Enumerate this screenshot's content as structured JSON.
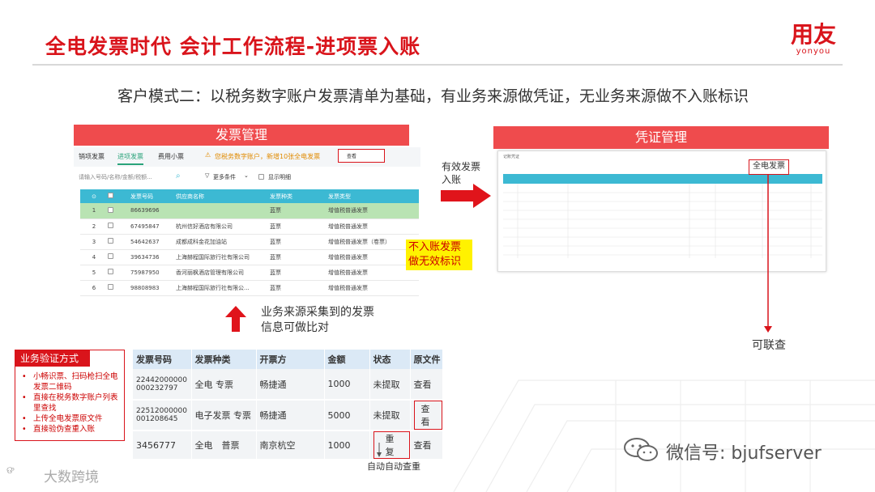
{
  "slide": {
    "title": "全电发票时代 会计工作流程-进项票入账",
    "brand_cn": "用友",
    "brand_en": "yonyou",
    "subtitle": "客户模式二：以税务数字账户发票清单为基础，有业务来源做凭证，无业务来源做不入账标识"
  },
  "invoice_panel": {
    "header": "发票管理",
    "tabs": [
      "销项发票",
      "进项发票",
      "费用小票"
    ],
    "notice": "您税务数字账户，新增10张全电发票",
    "notice_button": "查看",
    "search_placeholder": "请输入号码/名称/金额/税额...",
    "filter_label": "更多条件",
    "show_detail": "显示明细",
    "columns": [
      "",
      "",
      "发票号码",
      "供应商名称",
      "发票种类",
      "发票类型"
    ],
    "rows": [
      {
        "idx": "1",
        "no": "86639696",
        "supplier": "",
        "kind": "蓝票",
        "type": "增值税普通发票"
      },
      {
        "idx": "2",
        "no": "67495847",
        "supplier": "杭州信好酒店有限公司",
        "kind": "蓝票",
        "type": "增值税普通发票"
      },
      {
        "idx": "3",
        "no": "54642637",
        "supplier": "成都成科金花加油站",
        "kind": "蓝票",
        "type": "增值税普通发票（卷票）"
      },
      {
        "idx": "4",
        "no": "39634736",
        "supplier": "上海赫程国际旅行社有限公司",
        "kind": "蓝票",
        "type": "增值税普通发票"
      },
      {
        "idx": "5",
        "no": "75987950",
        "supplier": "香河丽枫酒店管理有限公司",
        "kind": "蓝票",
        "type": "增值税普通发票"
      },
      {
        "idx": "6",
        "no": "98808983",
        "supplier": "上海赫程国际旅行社有限公...",
        "kind": "蓝票",
        "type": "增值税普通发票"
      }
    ]
  },
  "arrow_right_label": "有效发票入账",
  "voucher_panel": {
    "header": "凭证管理",
    "title": "记账凭证",
    "quandian_button": "全电发票"
  },
  "annotation_not_booked": "不入账发票做无效标识",
  "annotation_traceable": "可联查",
  "annotation_compare": "业务来源采集到的发票信息可做比对",
  "verify": {
    "title": "业务验证方式",
    "items": [
      "小畅识票、扫码枪扫全电发票二维码",
      "直接在税务数字账户列表里查找",
      "上传全电发票原文件",
      "直接验伪查重入账"
    ]
  },
  "bottom_table": {
    "columns": [
      "发票号码",
      "发票种类",
      "开票方",
      "金额",
      "状态",
      "原文件"
    ],
    "rows": [
      {
        "no": "22442000000000232797",
        "kind": "全电 专票",
        "issuer": "畅捷通",
        "amount": "1000",
        "status": "未提取",
        "file": "查看"
      },
      {
        "no": "22512000000001208645",
        "kind": "电子发票 专票",
        "issuer": "畅捷通",
        "amount": "5000",
        "status": "未提取",
        "file": "查看"
      },
      {
        "no": "3456777",
        "kind": "全电　普票",
        "issuer": "南京杭空",
        "amount": "1000",
        "status": "重复",
        "file": "查看"
      }
    ]
  },
  "auto_check_label": "自动自动查重",
  "wechat": "微信号: bjufserver",
  "watermark": "大数跨境",
  "colors": {
    "accent_red": "#d9141b",
    "header_red": "#ef4b4d",
    "teal": "#3cb9d3",
    "highlight": "#fff200"
  }
}
